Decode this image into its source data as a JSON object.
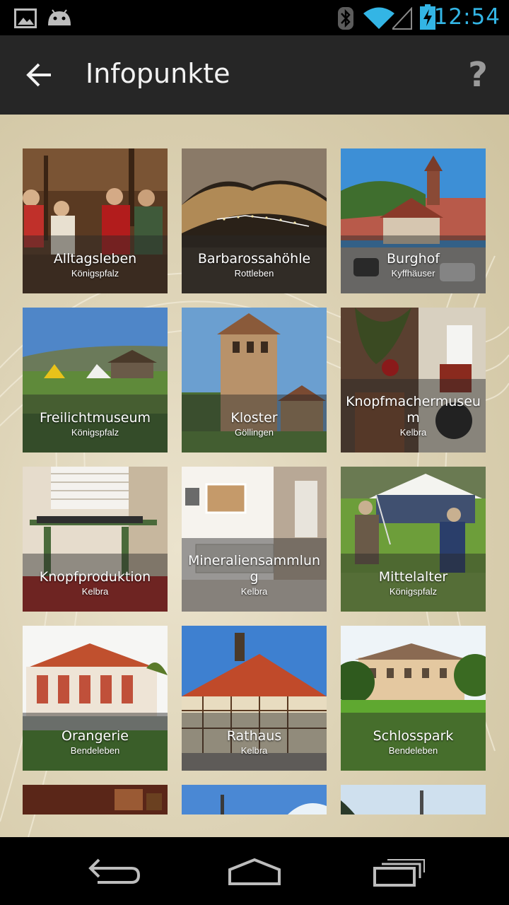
{
  "status_bar": {
    "time": "12:54",
    "icons": [
      "image-notification-icon",
      "android-notification-icon",
      "bluetooth-icon",
      "wifi-icon",
      "signal-icon",
      "battery-charging-icon"
    ],
    "accent": "#33b5e5"
  },
  "action_bar": {
    "title": "Infopunkte",
    "back_icon": "arrow-left-icon",
    "help_label": "?"
  },
  "tiles": [
    {
      "name": "Alltagsleben",
      "place": "Königspfalz"
    },
    {
      "name": "Barbarossahöhle",
      "place": "Rottleben"
    },
    {
      "name": "Burghof",
      "place": "Kyffhäuser"
    },
    {
      "name": "Freilichtmuseum",
      "place": "Königspfalz"
    },
    {
      "name": "Kloster",
      "place": "Göllingen"
    },
    {
      "name": "Knopfmachermuseum",
      "place": "Kelbra"
    },
    {
      "name": "Knopfproduktion",
      "place": "Kelbra"
    },
    {
      "name": "Mineraliensammlung",
      "place": "Kelbra"
    },
    {
      "name": "Mittelalter",
      "place": "Königspfalz"
    },
    {
      "name": "Orangerie",
      "place": "Bendeleben"
    },
    {
      "name": "Rathaus",
      "place": "Kelbra"
    },
    {
      "name": "Schlosspark",
      "place": "Bendeleben"
    }
  ],
  "nav_bar": {
    "buttons": [
      "back-nav-icon",
      "home-nav-icon",
      "recent-apps-icon"
    ]
  }
}
